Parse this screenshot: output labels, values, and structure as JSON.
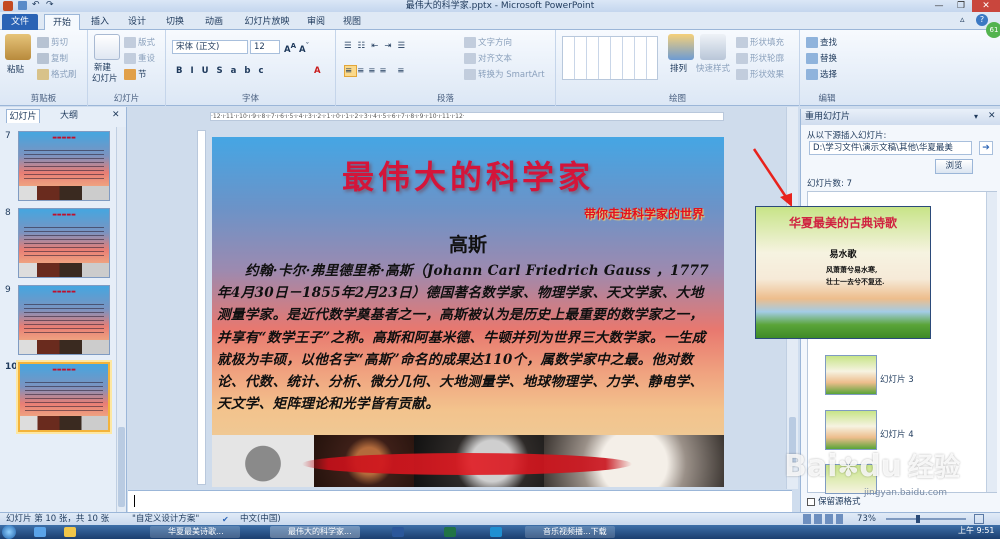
{
  "window": {
    "title": "最伟大的科学家.pptx - Microsoft PowerPoint"
  },
  "tabs": [
    "文件",
    "开始",
    "插入",
    "设计",
    "切换",
    "动画",
    "幻灯片放映",
    "审阅",
    "视图"
  ],
  "ribbon": {
    "clipboard": {
      "label": "剪贴板",
      "paste": "粘贴",
      "cut": "剪切",
      "copy": "复制",
      "format_painter": "格式刷"
    },
    "slides": {
      "label": "幻灯片",
      "new_slide_1": "新建",
      "new_slide_2": "幻灯片",
      "layout": "版式",
      "reset": "重设",
      "section": "节"
    },
    "font": {
      "label": "字体",
      "font_name": "宋体 (正文)",
      "font_size": "12"
    },
    "paragraph": {
      "label": "段落",
      "text_direction": "文字方向",
      "align_text": "对齐文本",
      "smartart": "转换为 SmartArt"
    },
    "drawing": {
      "label": "绘图",
      "arrange": "排列",
      "quick_styles": "快速样式",
      "shape_fill": "形状填充",
      "shape_outline": "形状轮廓",
      "shape_effects": "形状效果"
    },
    "editing": {
      "label": "编辑",
      "find": "查找",
      "replace": "替换",
      "select": "选择"
    }
  },
  "left_pane": {
    "tab_slides": "幻灯片",
    "tab_outline": "大纲",
    "numbers": [
      "7",
      "8",
      "9",
      "10"
    ]
  },
  "slide": {
    "title": "最伟大的科学家",
    "subtitle": "带你走进科学家的世界",
    "name": "高斯",
    "body": "约翰·卡尔·弗里德里希·高斯（Johann Carl Friedrich Gauss ，1777年4月30日－1855年2月23日）德国著名数学家、物理学家、天文学家、大地测量学家。是近代数学奠基者之一，高斯被认为是历史上最重要的数学家之一，并享有“数学王子”之称。高斯和阿基米德、牛顿并列为世界三大数学家。一生成就极为丰硕，以他名字“高斯”命名的成果达110个，属数学家中之最。他对数论、代数、统计、分析、微分几何、大地测量学、地球物理学、力学、静电学、天文学、矩阵理论和光学皆有贡献。"
  },
  "reuse_pane": {
    "title": "重用幻灯片",
    "insert_from": "从以下源插入幻灯片:",
    "path": "D:\\学习文件\\演示文稿\\其他\\华夏最美",
    "browse": "浏览",
    "count_label": "幻灯片数: 7",
    "items": [
      "幻灯片 3",
      "幻灯片 4"
    ],
    "keep_format": "保留源格式"
  },
  "popup": {
    "title": "华夏最美的古典诗歌",
    "poem_title": "易水歌",
    "line1": "风萧萧兮易水寒,",
    "line2": "壮士一去兮不复还."
  },
  "status": {
    "slide_info": "幻灯片 第 10 张，共 10 张",
    "theme": "\"自定义设计方案\"",
    "language": "中文(中国)",
    "zoom": "73%"
  },
  "taskbar": {
    "time": "上午 9:51",
    "task1": "华夏最美诗歌...",
    "task2": "最伟大的科学家...",
    "task3": "音乐视频播...下载"
  },
  "watermark": {
    "brand": "Bai",
    "du": "du",
    "jingyan": "经验",
    "url": "jingyan.baidu.com"
  }
}
